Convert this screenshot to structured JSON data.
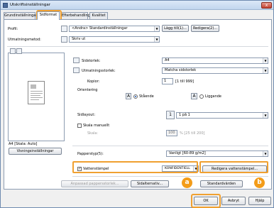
{
  "window": {
    "title": "Utskriftsinställningar",
    "close_glyph": "x"
  },
  "tabs": [
    {
      "label": "Grundinställningar"
    },
    {
      "label": "Sidformat"
    },
    {
      "label": "Efterbehandling"
    },
    {
      "label": "Kvalitet"
    }
  ],
  "profile": {
    "label": "Profil:",
    "value": "<Ändra> Standardinställningar",
    "add_button": "Lägg till(1)...",
    "edit_button": "Redigera(2)..."
  },
  "output": {
    "label": "Utmatningsmetod:",
    "value": "Skriv ut"
  },
  "preview": {
    "caption": "A4 [Skala: Auto]",
    "settings_button": "Visningsinställningar"
  },
  "page_size": {
    "label": "Sidstorlek:",
    "value": "A4"
  },
  "output_size": {
    "label": "Utmatningsstorlek:",
    "value": "Matcha sidstorlek"
  },
  "copies": {
    "label": "Kopior:",
    "value": "1",
    "range": "[1 till 999]"
  },
  "orientation": {
    "label": "Orientering",
    "portrait": "Stående",
    "landscape": "Liggande"
  },
  "layout": {
    "label": "Sidlayout:",
    "value": "1 på 1"
  },
  "scale": {
    "checkbox_label": "Skala manuellt",
    "label": "Skala:",
    "value": "100",
    "range": "% [25 till 200]"
  },
  "paper_type": {
    "label": "Papperstyp(5):",
    "value": "Vanligt [60-89 g/m2]"
  },
  "watermark": {
    "checkbox_label": "Vattenstämpel",
    "value": "KONFIDENTIELL",
    "edit_button": "Redigera vattenstämpel..."
  },
  "lower_buttons": {
    "custom_paper": "Anpassad pappersstorlek...",
    "page_options": "Sidalternativ...",
    "defaults": "Standardvärden"
  },
  "dialog_buttons": {
    "ok": "OK",
    "cancel": "Avbryt",
    "help": "Hjälp"
  },
  "callouts": {
    "a": "a",
    "b": "b"
  },
  "accent_color": "#f39c19"
}
